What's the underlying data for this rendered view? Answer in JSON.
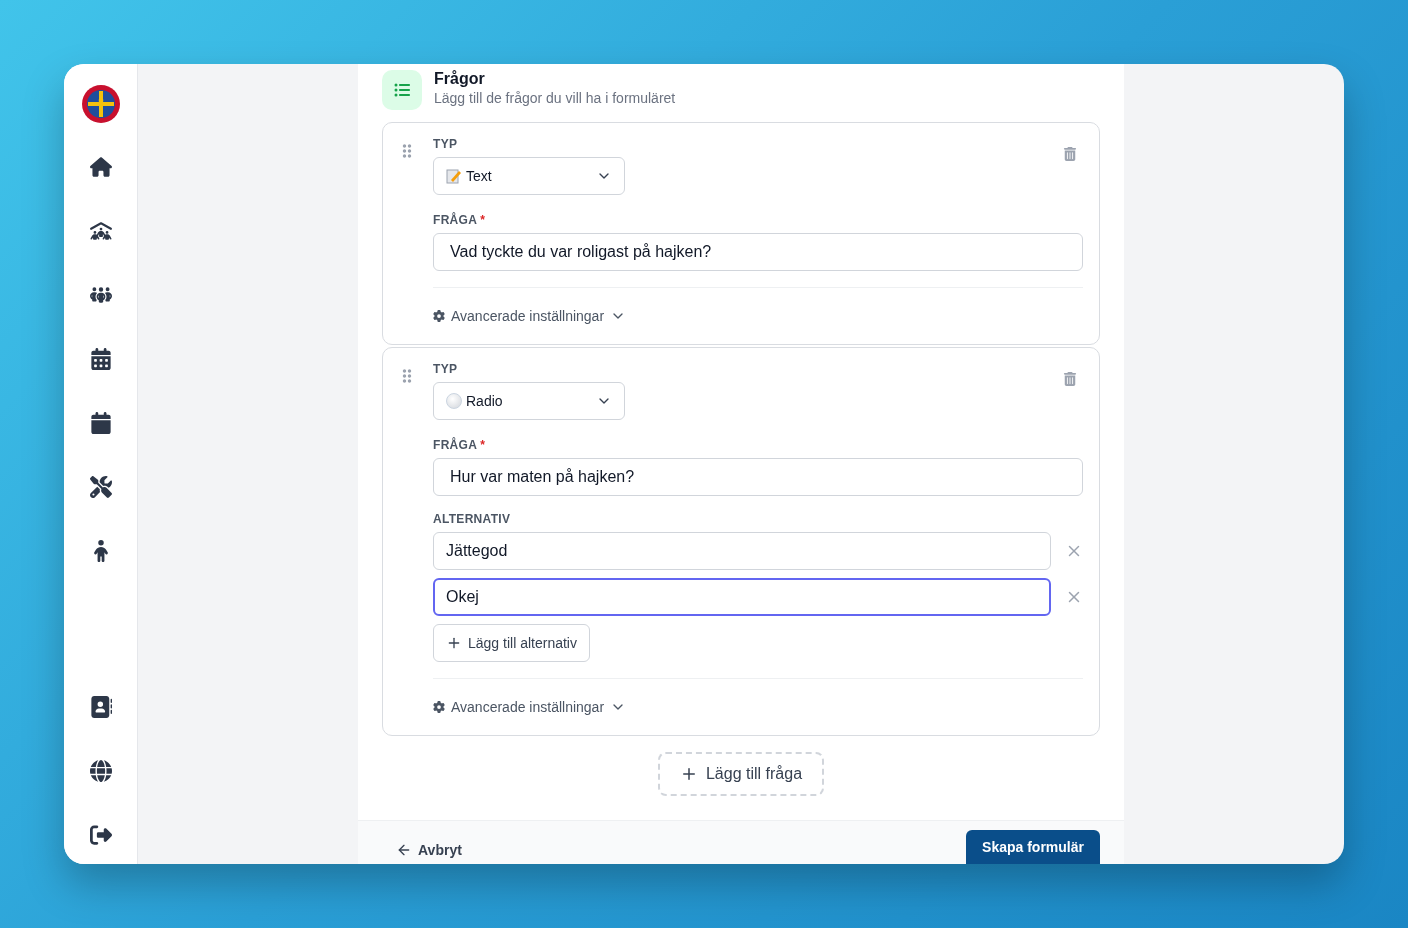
{
  "sidebar": {
    "items": [
      {
        "kind": "home"
      },
      {
        "kind": "roof-people"
      },
      {
        "kind": "group"
      },
      {
        "kind": "calendar-grid"
      },
      {
        "kind": "calendar"
      },
      {
        "kind": "tools"
      },
      {
        "kind": "child"
      }
    ],
    "bottom_items": [
      {
        "kind": "contacts"
      },
      {
        "kind": "globe"
      },
      {
        "kind": "logout"
      }
    ]
  },
  "section": {
    "title": "Frågor",
    "subtitle": "Lägg till de frågor du vill ha i formuläret"
  },
  "questions": [
    {
      "type_label": "TYP",
      "type": {
        "kind": "text",
        "label": "Text"
      },
      "question_label": "FRÅGA",
      "required_mark": "*",
      "question": "Vad tyckte du var roligast på hajken?",
      "advanced": "Avancerade inställningar"
    },
    {
      "type_label": "TYP",
      "type": {
        "kind": "radio",
        "label": "Radio"
      },
      "question_label": "FRÅGA",
      "required_mark": "*",
      "question": "Hur var maten på hajken?",
      "options_label": "ALTERNATIV",
      "options": [
        {
          "value": "Jättegod",
          "focused": false
        },
        {
          "value": "Okej",
          "focused": true
        }
      ],
      "add_option": "Lägg till alternativ",
      "advanced": "Avancerade inställningar"
    }
  ],
  "add_question": "Lägg till fråga",
  "footer": {
    "cancel": "Avbryt",
    "submit": "Skapa formulär"
  }
}
